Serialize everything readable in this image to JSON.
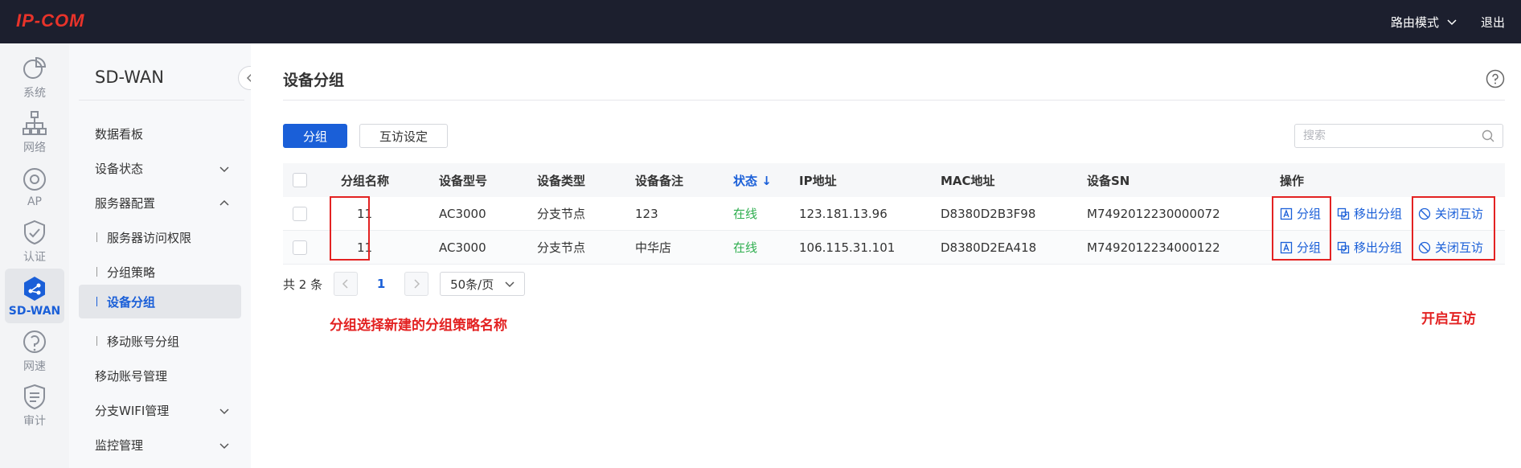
{
  "topbar": {
    "logo": "IP-COM",
    "mode_label": "路由模式",
    "logout_label": "退出"
  },
  "iconbar": [
    {
      "label": "系统",
      "icon": "pie-chart-icon"
    },
    {
      "label": "网络",
      "icon": "network-tree-icon"
    },
    {
      "label": "AP",
      "icon": "ap-icon"
    },
    {
      "label": "认证",
      "icon": "auth-shield-icon"
    },
    {
      "label": "SD-WAN",
      "icon": "sdwan-icon"
    },
    {
      "label": "网速",
      "icon": "speed-gauge-icon"
    },
    {
      "label": "审计",
      "icon": "audit-icon"
    }
  ],
  "sidenav": {
    "title": "SD-WAN",
    "items": [
      {
        "label": "数据看板"
      },
      {
        "label": "设备状态"
      },
      {
        "label": "服务器配置"
      },
      {
        "label": "服务器访问权限"
      },
      {
        "label": "分组策略"
      },
      {
        "label": "设备分组"
      },
      {
        "label": "移动账号分组"
      },
      {
        "label": "移动账号管理"
      },
      {
        "label": "分支WIFI管理"
      },
      {
        "label": "监控管理"
      }
    ]
  },
  "main": {
    "title": "设备分组",
    "tabs": [
      "分组",
      "互访设定"
    ],
    "search_placeholder": "搜索",
    "columns": [
      "分组名称",
      "设备型号",
      "设备类型",
      "设备备注",
      "状态 ↓",
      "IP地址",
      "MAC地址",
      "设备SN",
      "操作"
    ],
    "rows": [
      {
        "group": "11",
        "model": "AC3000",
        "type": "分支节点",
        "note": "123",
        "status": "在线",
        "ip": "123.181.13.96",
        "mac": "D8380D2B3F98",
        "sn": "M7492012230000072"
      },
      {
        "group": "11",
        "model": "AC3000",
        "type": "分支节点",
        "note": "中华店",
        "status": "在线",
        "ip": "106.115.31.101",
        "mac": "D8380D2EA418",
        "sn": "M7492012234000122"
      }
    ],
    "actions": {
      "group": "分组",
      "move_out": "移出分组",
      "disable_access": "关闭互访"
    },
    "pager": {
      "total": "共 2 条",
      "page": "1",
      "page_size": "50条/页"
    }
  },
  "annotations": {
    "left": "分组选择新建的分组策略名称",
    "right": "开启互访"
  },
  "colors": {
    "accent": "#1a5fd8",
    "online": "#2fae4f",
    "annotation": "#e32222",
    "topbar": "#1c1f2e"
  }
}
